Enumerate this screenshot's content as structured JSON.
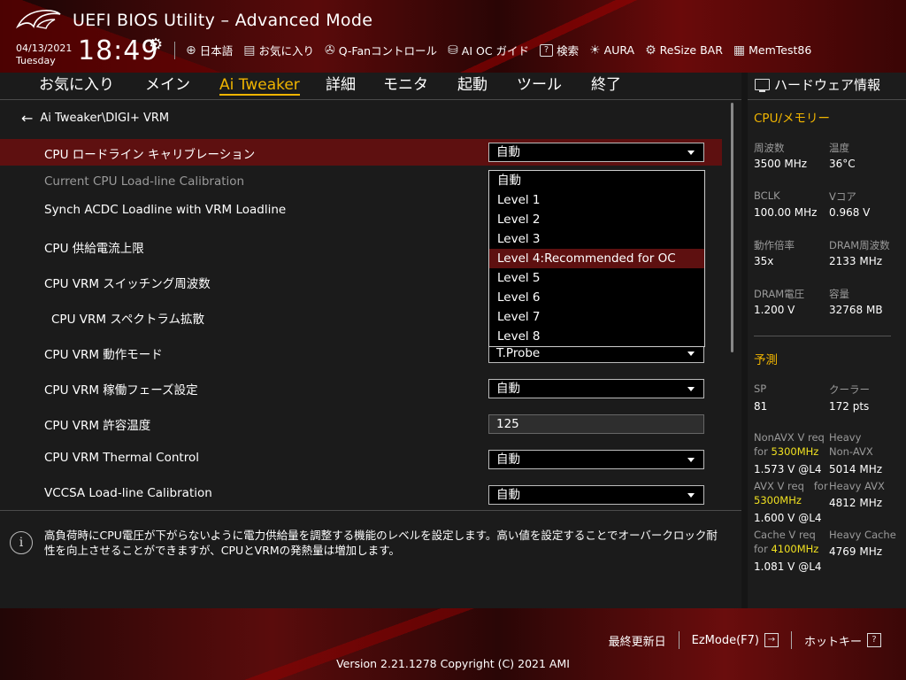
{
  "header": {
    "title": "UEFI BIOS Utility – Advanced Mode",
    "date": "04/13/2021",
    "day": "Tuesday",
    "time": "18:49",
    "toolbar": [
      {
        "label": "日本語",
        "icon": "globe-icon"
      },
      {
        "label": "お気に入り",
        "icon": "favorites-icon"
      },
      {
        "label": "Q-Fanコントロール",
        "icon": "fan-icon"
      },
      {
        "label": "AI OC ガイド",
        "icon": "ai-oc-icon"
      },
      {
        "label": "検索",
        "icon": "help-search-icon"
      },
      {
        "label": "AURA",
        "icon": "aura-icon"
      },
      {
        "label": "ReSize BAR",
        "icon": "resize-bar-icon"
      },
      {
        "label": "MemTest86",
        "icon": "memtest-icon"
      }
    ]
  },
  "nav": {
    "tabs": [
      "お気に入り",
      "メイン",
      "Ai Tweaker",
      "詳細",
      "モニタ",
      "起動",
      "ツール",
      "終了"
    ],
    "active": "Ai Tweaker"
  },
  "breadcrumb": "Ai Tweaker\\DIGI+ VRM",
  "settings": [
    {
      "label": "CPU ロードライン キャリブレーション",
      "value": "自動"
    },
    {
      "label": "Current CPU Load-line Calibration",
      "value": ""
    },
    {
      "label": "Synch ACDC Loadline with VRM Loadline",
      "value": ""
    },
    {
      "label": "CPU 供給電流上限",
      "value": ""
    },
    {
      "label": "CPU VRM スイッチング周波数",
      "value": ""
    },
    {
      "label": "CPU VRM スペクトラム拡散",
      "value": ""
    },
    {
      "label": "CPU VRM 動作モード",
      "value": "T.Probe"
    },
    {
      "label": "CPU VRM 稼働フェーズ設定",
      "value": "自動"
    },
    {
      "label": "CPU VRM 許容温度",
      "value": "125"
    },
    {
      "label": "CPU VRM Thermal Control",
      "value": "自動"
    },
    {
      "label": "VCCSA Load-line Calibration",
      "value": "自動"
    }
  ],
  "dropdown": {
    "options": [
      "自動",
      "Level 1",
      "Level 2",
      "Level 3",
      "Level 4:Recommended for OC",
      "Level 5",
      "Level 6",
      "Level 7",
      "Level 8"
    ],
    "selected": "Level 4:Recommended for OC"
  },
  "help": "高負荷時にCPU電圧が下がらないように電力供給量を調整する機能のレベルを設定します。高い値を設定することでオーバークロック耐性を向上させることができますが、CPUとVRMの発熱量は増加します。",
  "hardware": {
    "title": "ハードウェア情報",
    "cpu_section": "CPU/メモリー",
    "cpu_items": [
      {
        "label": "周波数",
        "value": "3500 MHz"
      },
      {
        "label": "温度",
        "value": "36°C"
      },
      {
        "label": "BCLK",
        "value": "100.00 MHz"
      },
      {
        "label": "Vコア",
        "value": "0.968 V"
      },
      {
        "label": "動作倍率",
        "value": "35x"
      },
      {
        "label": "DRAM周波数",
        "value": "2133 MHz"
      },
      {
        "label": "DRAM電圧",
        "value": "1.200 V"
      },
      {
        "label": "容量",
        "value": "32768 MB"
      }
    ],
    "predict_section": "予測",
    "sp_label": "SP",
    "sp_value": "81",
    "cooler_label": "クーラー",
    "cooler_value": "172 pts",
    "nonavx_req": "NonAVX V req",
    "for1": "for",
    "nonavx_freq": "5300MHz",
    "nonavx_v": "1.573 V @L4",
    "heavy_nonavx": "Heavy",
    "heavy_nonavx2": "Non-AVX",
    "heavy_nonavx_val": "5014 MHz",
    "avx_req": "AVX V req",
    "for2": "for",
    "avx_freq": "5300MHz",
    "avx_v": "1.600 V @L4",
    "heavy_avx": "Heavy AVX",
    "heavy_avx_val": "4812 MHz",
    "cache_req": "Cache V req",
    "for3": "for",
    "cache_freq": "4100MHz",
    "cache_v": "1.081 V @L4",
    "heavy_cache": "Heavy Cache",
    "heavy_cache_val": "4769 MHz"
  },
  "footer": {
    "last_modified": "最終更新日",
    "ezmode": "EzMode(F7)",
    "hotkeys": "ホットキー",
    "hotkey_icon_text": "?",
    "version": "Version 2.21.1278 Copyright (C) 2021 AMI"
  },
  "colors": {
    "accent": "#f0b400",
    "highlight": "#5e1010",
    "predict_yellow": "#f0e020"
  }
}
